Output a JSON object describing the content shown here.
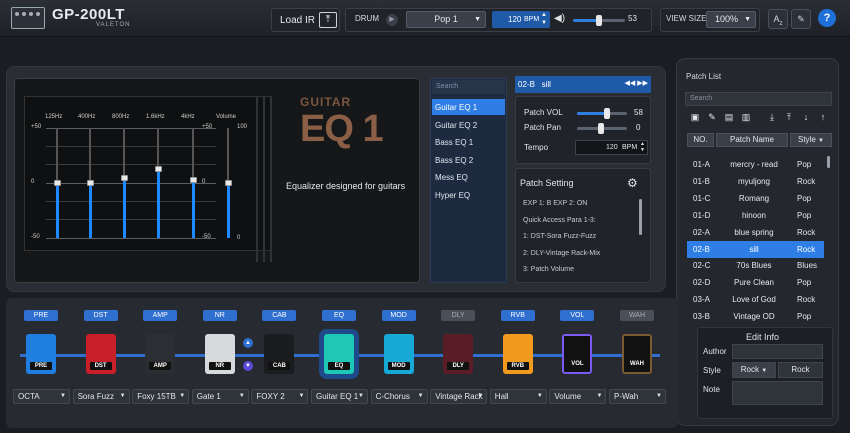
{
  "app": {
    "title": "GP-200LT",
    "subtitle": "VALETON"
  },
  "toolbar": {
    "load_ir": "Load IR",
    "drum_label": "DRUM",
    "drum_pattern": "Pop 1",
    "bpm_value": "120",
    "bpm_unit": "BPM",
    "volume_value": "53",
    "volume_level": 0.5,
    "view_size_label": "VIEW SIZE",
    "view_size_value": "100%"
  },
  "module_screen": {
    "brand_line": "GUITAR",
    "brand_name": "EQ 1",
    "description": "Equalizer designed for guitars",
    "bands": [
      "125Hz",
      "400Hz",
      "800Hz",
      "1.6kHz",
      "4kHz",
      "Volume"
    ],
    "left_scale": [
      "+50",
      "0",
      "-50"
    ],
    "right_scale": [
      "+50",
      "0",
      "-50"
    ],
    "volume_scale": [
      "100",
      "0"
    ],
    "band_levels": [
      0,
      0,
      5,
      13,
      3,
      0
    ]
  },
  "eq_list": {
    "search_placeholder": "Search",
    "items": [
      "Guitar EQ 1",
      "Guitar EQ 2",
      "Bass EQ 1",
      "Bass EQ 2",
      "Mess EQ",
      "Hyper EQ"
    ],
    "selected_index": 0
  },
  "patch": {
    "id": "02-B",
    "name": "sill",
    "vol_label": "Patch VOL",
    "vol_value": "58",
    "pan_label": "Patch Pan",
    "pan_value": "0",
    "tempo_label": "Tempo",
    "tempo_value": "120",
    "tempo_unit": "BPM"
  },
  "patch_setting": {
    "title": "Patch Setting",
    "lines": [
      "EXP 1: B   EXP 2: ON",
      "Quick Access Para 1-3:",
      "1: DST-Sora Fuzz-Fuzz",
      "2: DLY-Vintage Rack-Mix",
      "3: Patch Volume"
    ]
  },
  "patch_list": {
    "title": "Patch List",
    "search_placeholder": "Search",
    "col_no": "NO.",
    "col_name": "Patch Name",
    "col_style": "Style",
    "rows": [
      {
        "no": "01-A",
        "name": "mercry - read",
        "style": "Pop"
      },
      {
        "no": "01-B",
        "name": "myuljong",
        "style": "Rock"
      },
      {
        "no": "01-C",
        "name": "Romang",
        "style": "Pop"
      },
      {
        "no": "01-D",
        "name": "hinoon",
        "style": "Pop"
      },
      {
        "no": "02-A",
        "name": "blue spring",
        "style": "Rock"
      },
      {
        "no": "02-B",
        "name": "sill",
        "style": "Rock"
      },
      {
        "no": "02-C",
        "name": "70s Blues",
        "style": "Blues"
      },
      {
        "no": "02-D",
        "name": "Pure Clean",
        "style": "Pop"
      },
      {
        "no": "03-A",
        "name": "Love of God",
        "style": "Rock"
      },
      {
        "no": "03-B",
        "name": "Vintage OD",
        "style": "Pop"
      }
    ],
    "selected_index": 5
  },
  "edit_info": {
    "title": "Edit Info",
    "author_label": "Author",
    "style_label": "Style",
    "style_value": "Rock",
    "style_text": "Rock",
    "note_label": "Note"
  },
  "chain": [
    {
      "label": "PRE",
      "pedal": "PRE",
      "select": "OCTA",
      "color": "#1e7fe0",
      "on": true
    },
    {
      "label": "DST",
      "pedal": "DST",
      "select": "Sora Fuzz",
      "color": "#c81f2b",
      "on": true
    },
    {
      "label": "AMP",
      "pedal": "AMP",
      "select": "Foxy 15TB",
      "color": "#2b2e33",
      "on": true
    },
    {
      "label": "NR",
      "pedal": "NR",
      "select": "Gate 1",
      "color": "#d7d9dd",
      "on": true
    },
    {
      "label": "CAB",
      "pedal": "CAB",
      "select": "FOXY 2",
      "color": "#1b1c1f",
      "on": true
    },
    {
      "label": "EQ",
      "pedal": "EQ",
      "select": "Guitar EQ 1",
      "color": "#1fc7b7",
      "on": true
    },
    {
      "label": "MOD",
      "pedal": "MOD",
      "select": "C-Chorus",
      "color": "#17a9d6",
      "on": true
    },
    {
      "label": "DLY",
      "pedal": "DLY",
      "select": "Vintage Rack",
      "color": "#5a1c26",
      "on": false
    },
    {
      "label": "RVB",
      "pedal": "RVB",
      "select": "Hall",
      "color": "#f39a1e",
      "on": true
    },
    {
      "label": "VOL",
      "pedal": "VOL",
      "select": "Volume",
      "color": "#5a3cc8",
      "on": true
    },
    {
      "label": "WAH",
      "pedal": "WAH",
      "select": "P-Wah",
      "color": "#3a2f25",
      "on": false
    }
  ],
  "icons": {
    "upload": "upload-icon",
    "play": "play-icon",
    "speaker": "speaker-icon",
    "font": "font-size-icon",
    "wrench": "wrench-icon",
    "help": "help-icon",
    "gear": "gear-icon"
  }
}
